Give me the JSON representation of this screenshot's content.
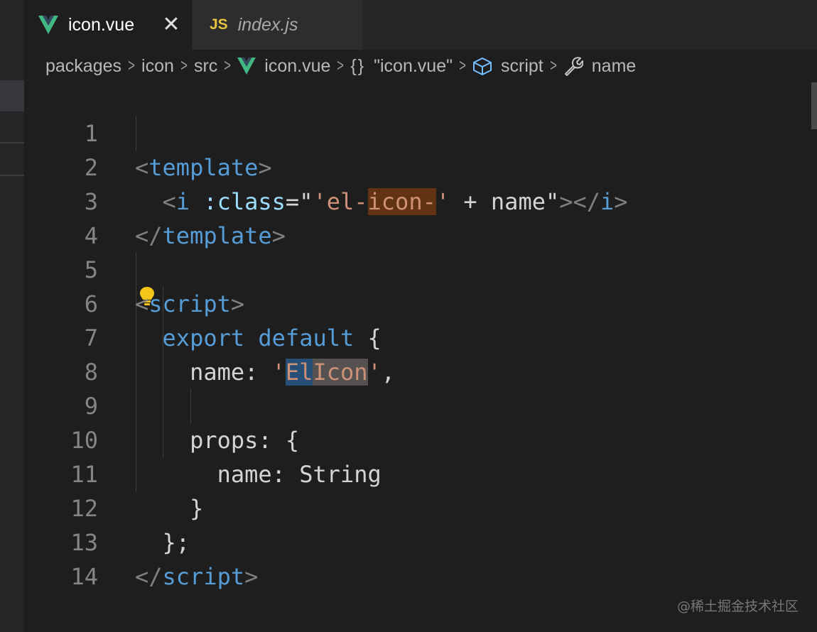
{
  "tabs": [
    {
      "label": "icon.vue",
      "icon": "vue-logo-icon",
      "active": true,
      "close": "✕"
    },
    {
      "label": "index.js",
      "icon": "js-file-icon",
      "badge": "JS",
      "active": false
    }
  ],
  "breadcrumbs": {
    "items": [
      "packages",
      "icon",
      "src",
      "icon.vue",
      "{}",
      "\"icon.vue\"",
      "script",
      "name"
    ]
  },
  "editor": {
    "lines": [
      {
        "n": "1"
      },
      {
        "n": "2"
      },
      {
        "n": "3"
      },
      {
        "n": "4"
      },
      {
        "n": "5"
      },
      {
        "n": "6"
      },
      {
        "n": "7"
      },
      {
        "n": "8"
      },
      {
        "n": "9"
      },
      {
        "n": "10"
      },
      {
        "n": "11"
      },
      {
        "n": "12"
      },
      {
        "n": "13"
      },
      {
        "n": "14"
      }
    ],
    "t": {
      "lt": "<",
      "ltslash": "</",
      "gt": ">",
      "template": "template",
      "script": "script",
      "i": "i",
      "class_attr": ":class",
      "eq_quote": "=\"",
      "str_open": "'el-",
      "str_hl": "icon-",
      "str_close": "'",
      "plus_name": " + name",
      "quote": "\"",
      "close_i_open": "></",
      "export": "export",
      "default": "default",
      "brace_open": " {",
      "name_key": "name: ",
      "q1": "'",
      "el": "El",
      "icon_word": "Icon",
      "q2": "'",
      "comma": ",",
      "props": "props: {",
      "name_string": "name: String",
      "brace_close": "}",
      "semicolon_close": "};"
    }
  },
  "watermark": "@稀土掘金技术社区",
  "colors": {
    "background": "#1e1e1e",
    "tag": "#569cd6",
    "attribute": "#9cdcfe",
    "string": "#ce9178",
    "vue_green": "#41b883",
    "js_yellow": "#e5c33f",
    "bulb_yellow": "#f5c518"
  }
}
